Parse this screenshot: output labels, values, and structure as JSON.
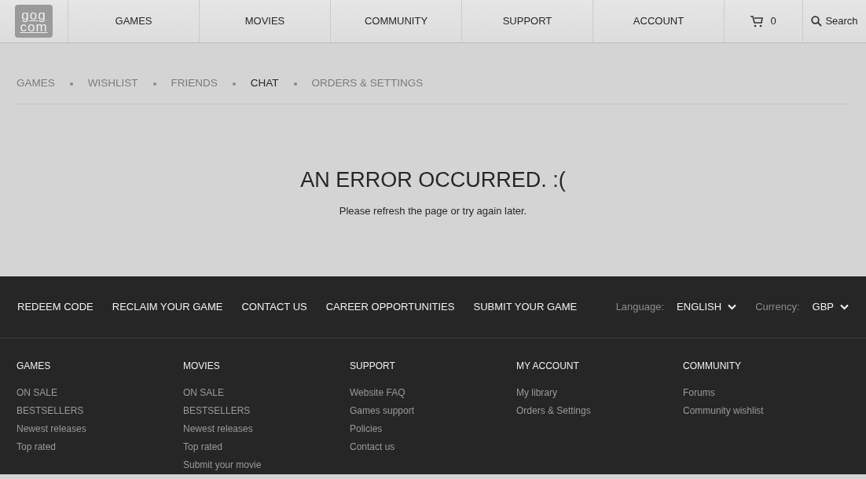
{
  "header": {
    "logo": [
      "gog",
      "com"
    ],
    "nav": [
      "GAMES",
      "MOVIES",
      "COMMUNITY",
      "SUPPORT",
      "ACCOUNT"
    ],
    "cart_count": "0",
    "search": "Search"
  },
  "subnav": [
    {
      "label": "GAMES",
      "selected": false
    },
    {
      "label": "WISHLIST",
      "selected": false
    },
    {
      "label": "FRIENDS",
      "selected": false
    },
    {
      "label": "CHAT",
      "selected": true
    },
    {
      "label": "ORDERS & SETTINGS",
      "selected": false
    }
  ],
  "error": {
    "title": "AN ERROR OCCURRED. :(",
    "message": "Please refresh the page or try again later."
  },
  "footer": {
    "links": [
      "REDEEM CODE",
      "RECLAIM YOUR GAME",
      "CONTACT US",
      "CAREER OPPORTUNITIES",
      "SUBMIT YOUR GAME"
    ],
    "language": {
      "label": "Language:",
      "value": "ENGLISH"
    },
    "currency": {
      "label": "Currency:",
      "value": "GBP"
    },
    "columns": [
      {
        "heading": "GAMES",
        "links": [
          "ON SALE",
          "BESTSELLERS",
          "Newest releases",
          "Top rated"
        ]
      },
      {
        "heading": "MOVIES",
        "links": [
          "ON SALE",
          "BESTSELLERS",
          "Newest releases",
          "Top rated",
          "Submit your movie"
        ]
      },
      {
        "heading": "SUPPORT",
        "links": [
          "Website FAQ",
          "Games support",
          "Policies",
          "Contact us"
        ]
      },
      {
        "heading": "MY ACCOUNT",
        "links": [
          "My library",
          "Orders & Settings"
        ]
      },
      {
        "heading": "COMMUNITY",
        "links": [
          "Forums",
          "Community wishlist"
        ]
      }
    ]
  }
}
